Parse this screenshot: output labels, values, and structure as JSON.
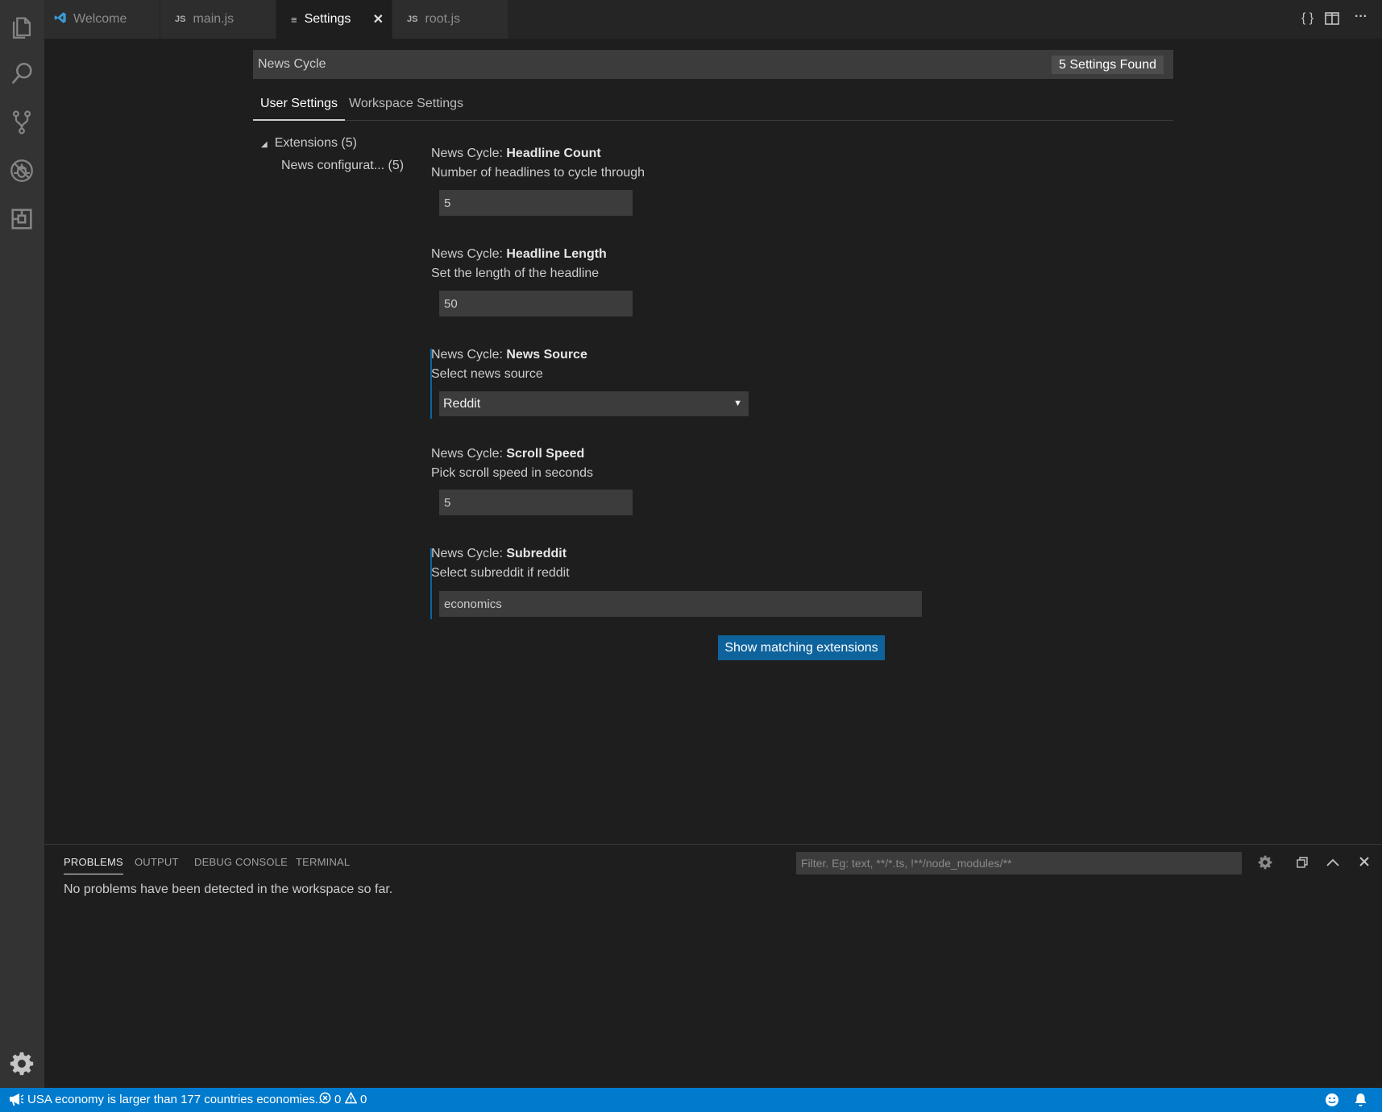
{
  "tabs": [
    {
      "label": "Welcome",
      "icon": "vscode-logo-icon"
    },
    {
      "label": "main.js",
      "icon": "js-file-icon",
      "icon_text": "JS"
    },
    {
      "label": "Settings",
      "icon": "settings-file-icon",
      "icon_text": "≡",
      "active": true
    },
    {
      "label": "root.js",
      "icon": "js-file-icon",
      "icon_text": "JS"
    }
  ],
  "tab_close_glyph": "✕",
  "tabbar_actions": {
    "open_json": "{ }",
    "split": "split-editor-icon",
    "more": "···"
  },
  "search": {
    "value": "News Cycle",
    "result_badge": "5 Settings Found"
  },
  "settings_tabs": [
    "User Settings",
    "Workspace Settings"
  ],
  "toc": {
    "group": "Extensions (5)",
    "item": "News configurat... (5)"
  },
  "settings": [
    {
      "prefix": "News Cycle: ",
      "name": "Headline Count",
      "description": "Number of headlines to cycle through",
      "value": "5"
    },
    {
      "prefix": "News Cycle: ",
      "name": "Headline Length",
      "description": "Set the length of the headline",
      "value": "50"
    },
    {
      "prefix": "News Cycle: ",
      "name": "News Source",
      "description": "Select news source",
      "value": "Reddit"
    },
    {
      "prefix": "News Cycle: ",
      "name": "Scroll Speed",
      "description": "Pick scroll speed in seconds",
      "value": "5"
    },
    {
      "prefix": "News Cycle: ",
      "name": "Subreddit",
      "description": "Select subreddit if reddit",
      "value": "economics"
    }
  ],
  "show_extensions_label": "Show matching extensions",
  "panel": {
    "tabs": [
      "PROBLEMS",
      "OUTPUT",
      "DEBUG CONSOLE",
      "TERMINAL"
    ],
    "filter_placeholder": "Filter. Eg: text, **/*.ts, !**/node_modules/**",
    "message": "No problems have been detected in the workspace so far."
  },
  "status": {
    "news_ticker": "USA economy is larger than 177 countries economies...",
    "errors": "0",
    "warnings": "0"
  },
  "colors": {
    "accent": "#007acc",
    "button": "#0e639c",
    "modified_bar": "#0e639c"
  }
}
